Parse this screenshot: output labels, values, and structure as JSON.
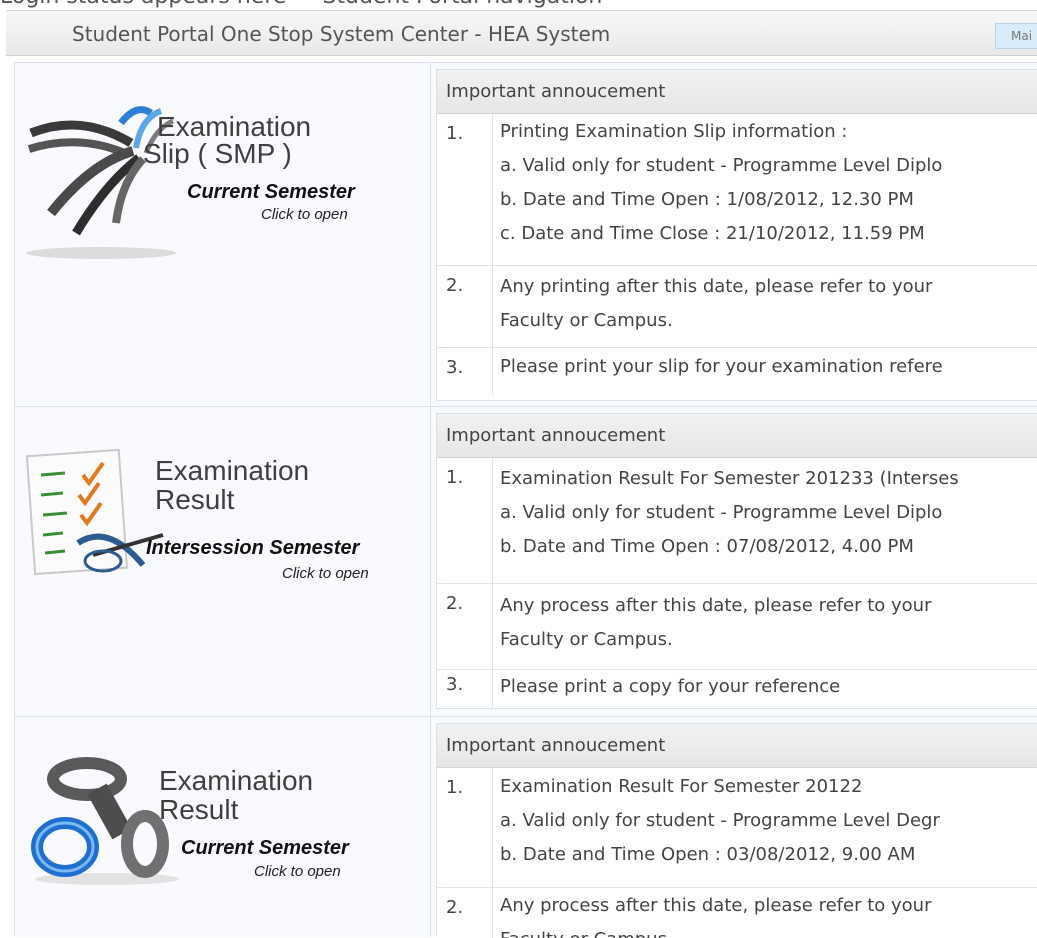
{
  "top_strip_text": "Login status appears here — Student Portal navigation",
  "header": {
    "title": "Student Portal One Stop System Center  - HEA System",
    "main_button_label": "Mai"
  },
  "sections": [
    {
      "banner": {
        "line1": "Examination",
        "line2": "Slip ( SMP )",
        "semester": "Current Semester",
        "action": "Click to open",
        "icon": "exam-slip-swirl-icon"
      },
      "announcement": {
        "heading": "Important annoucement",
        "items": [
          {
            "num": "1.",
            "lines": [
              "Printing Examination Slip information :",
              "a. Valid only for student - Programme Level Diplo",
              "b. Date and Time Open : 1/08/2012, 12.30 PM",
              "c. Date and Time Close : 21/10/2012, 11.59 PM"
            ]
          },
          {
            "num": "2.",
            "lines": [
              "Any printing after this date, please refer to your",
              "Faculty or Campus."
            ]
          },
          {
            "num": "3.",
            "lines": [
              "Please print your slip for your examination refere"
            ]
          }
        ]
      }
    },
    {
      "banner": {
        "line1": "Examination",
        "line2": "Result",
        "semester": "Intersession Semester",
        "action": "Click to open",
        "icon": "checklist-pen-icon"
      },
      "announcement": {
        "heading": "Important annoucement",
        "items": [
          {
            "num": "1.",
            "lines": [
              "Examination Result For Semester 201233 (Interses",
              "a. Valid only for student - Programme Level Diplo",
              "b. Date and Time Open : 07/08/2012, 4.00 PM"
            ]
          },
          {
            "num": "2.",
            "lines": [
              "Any process after this date, please refer to your",
              "Faculty or Campus."
            ]
          },
          {
            "num": "3.",
            "lines": [
              "Please print a copy for your reference"
            ]
          }
        ]
      }
    },
    {
      "banner": {
        "line1": "Examination",
        "line2": "Result",
        "semester": "Current Semester",
        "action": "Click to open",
        "icon": "rings-3d-icon"
      },
      "announcement": {
        "heading": "Important annoucement",
        "items": [
          {
            "num": "1.",
            "lines": [
              "Examination Result For Semester 20122",
              "a. Valid only for student - Programme Level Degr",
              "b. Date and Time Open : 03/08/2012, 9.00 AM"
            ]
          },
          {
            "num": "2.",
            "lines": [
              "Any process after this date, please refer to your",
              "Faculty or Campus."
            ]
          }
        ]
      }
    }
  ]
}
